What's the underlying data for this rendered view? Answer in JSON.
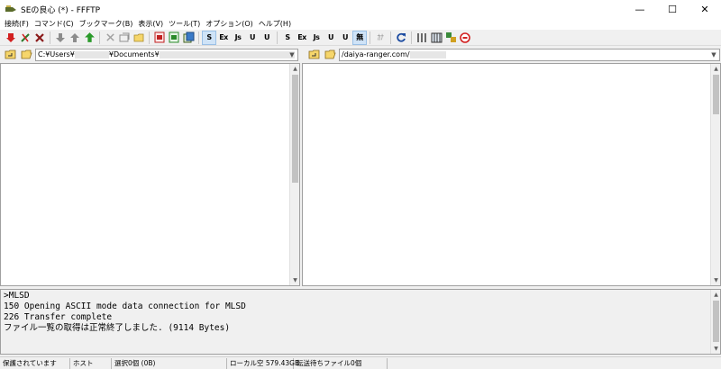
{
  "window": {
    "title": "SEの良心 (*) - FFFTP",
    "controls": {
      "minimize": "—",
      "maximize": "☐",
      "close": "✕"
    }
  },
  "menu": [
    {
      "label": "接続(F)"
    },
    {
      "label": "コマンド(C)"
    },
    {
      "label": "ブックマーク(B)"
    },
    {
      "label": "表示(V)"
    },
    {
      "label": "ツール(T)"
    },
    {
      "label": "オプション(O)"
    },
    {
      "label": "ヘルプ(H)"
    }
  ],
  "toolbar": {
    "transfer_modes": [
      "S",
      "Ex",
      "Js",
      "U",
      "U"
    ],
    "remote_modes": [
      "S",
      "Ex",
      "Js",
      "U",
      "U",
      "無"
    ],
    "kana_label": "ｶﾅ"
  },
  "local": {
    "path_prefix": "C:¥Users¥",
    "path_middle": "¥Documents¥"
  },
  "remote": {
    "path_prefix": "/daiya-ranger.com/"
  },
  "log": {
    "lines": [
      ">MLSD",
      "150 Opening ASCII mode data connection for MLSD",
      "226 Transfer complete",
      "ファイル一覧の取得は正常終了しました. (9114 Bytes)"
    ]
  },
  "status": {
    "security": "保護されています",
    "host": "ホスト",
    "selection": "選択0個 (0B)",
    "local_free": "ローカル空 579.43GB",
    "queue": "転送待ちファイル0個"
  },
  "colors": {
    "accent": "#cfe3f7",
    "red_icon": "#d22020",
    "green_icon": "#2a9a2a"
  }
}
